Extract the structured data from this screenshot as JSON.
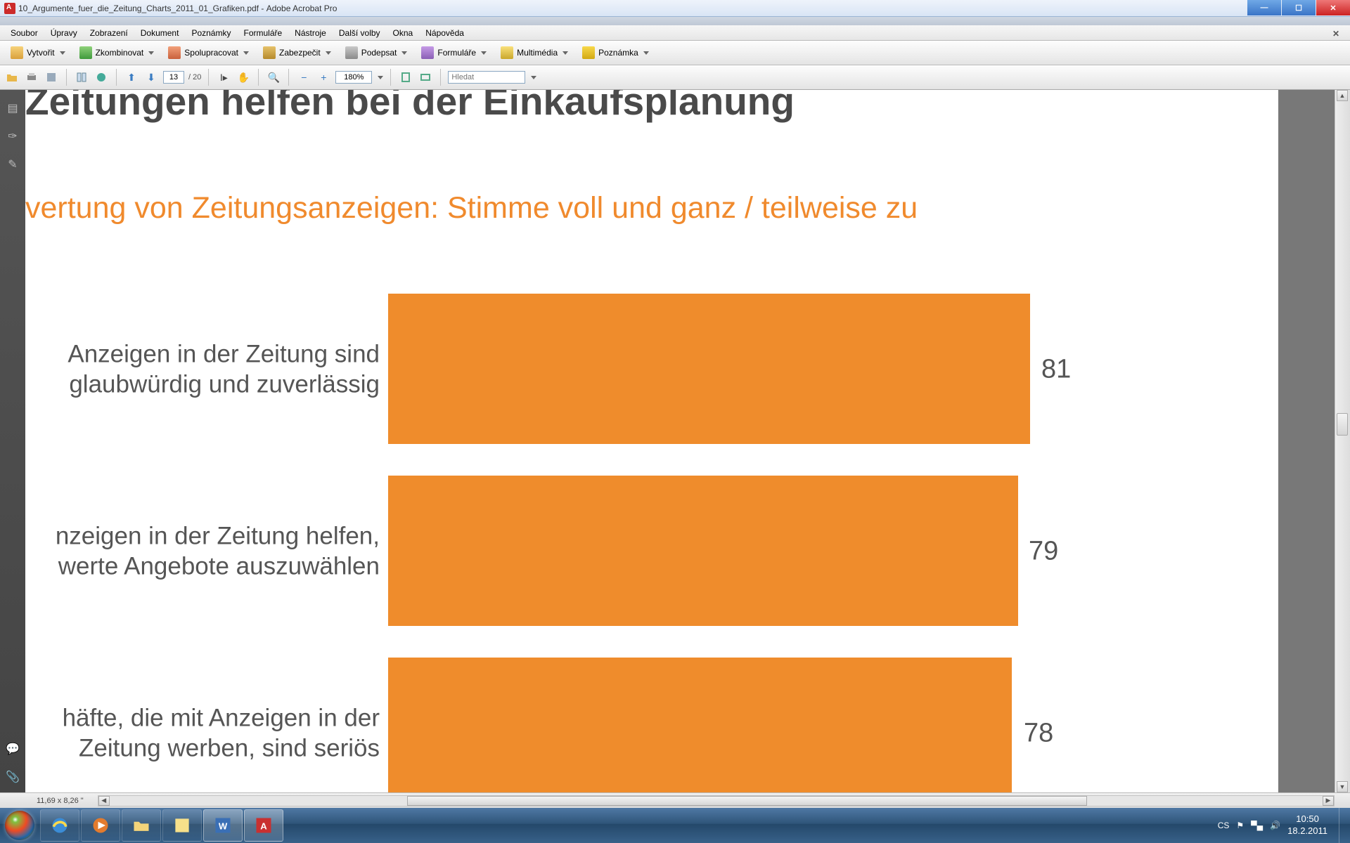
{
  "titlebar": {
    "filename": "10_Argumente_fuer_die_Zeitung_Charts_2011_01_Grafiken.pdf",
    "app": "Adobe Acrobat Pro"
  },
  "win_controls": {
    "min": "—",
    "max": "☐",
    "close": "✕"
  },
  "menu": [
    "Soubor",
    "Úpravy",
    "Zobrazení",
    "Dokument",
    "Poznámky",
    "Formuláře",
    "Nástroje",
    "Další volby",
    "Okna",
    "Nápověda"
  ],
  "toolbar": [
    {
      "id": "create",
      "label": "Vytvořit"
    },
    {
      "id": "combine",
      "label": "Zkombinovat"
    },
    {
      "id": "collab",
      "label": "Spolupracovat"
    },
    {
      "id": "secure",
      "label": "Zabezpečit"
    },
    {
      "id": "sign",
      "label": "Podepsat"
    },
    {
      "id": "forms",
      "label": "Formuláře"
    },
    {
      "id": "media",
      "label": "Multimédia"
    },
    {
      "id": "comment",
      "label": "Poznámka"
    }
  ],
  "toolbar2": {
    "page": "13",
    "page_total": "/ 20",
    "zoom": "180%",
    "search_ph": "Hledat"
  },
  "navpane": {
    "icons": [
      "page-thumbnails",
      "bookmarks",
      "signatures"
    ],
    "bottom": [
      "comments",
      "attachments"
    ]
  },
  "doc": {
    "title": "Zeitungen helfen bei der Einkaufsplanung",
    "subtitle": "vertung von Zeitungsanzeigen: Stimme voll und ganz / teilweise zu"
  },
  "chart_data": {
    "type": "bar",
    "orientation": "horizontal",
    "title": "Zeitungen helfen bei der Einkaufsplanung",
    "subtitle": "Bewertung von Zeitungsanzeigen: Stimme voll und ganz / teilweise zu",
    "categories": [
      "Anzeigen in der Zeitung sind glaubwürdig und zuverlässig",
      "nzeigen in der Zeitung helfen, werte Angebote auszuwählen",
      "häfte, die mit Anzeigen in der Zeitung werben, sind seriös"
    ],
    "values": [
      81,
      79,
      78
    ],
    "xlim": [
      0,
      100
    ],
    "color": "#ef8c2c",
    "xlabel": "",
    "ylabel": ""
  },
  "status": {
    "dim": "11,69 x 8,26 \""
  },
  "taskbar": {
    "apps": [
      "ie",
      "wmp",
      "explorer",
      "sticky",
      "word",
      "reader"
    ],
    "lang": "CS",
    "time": "10:50",
    "date": "18.2.2011"
  }
}
